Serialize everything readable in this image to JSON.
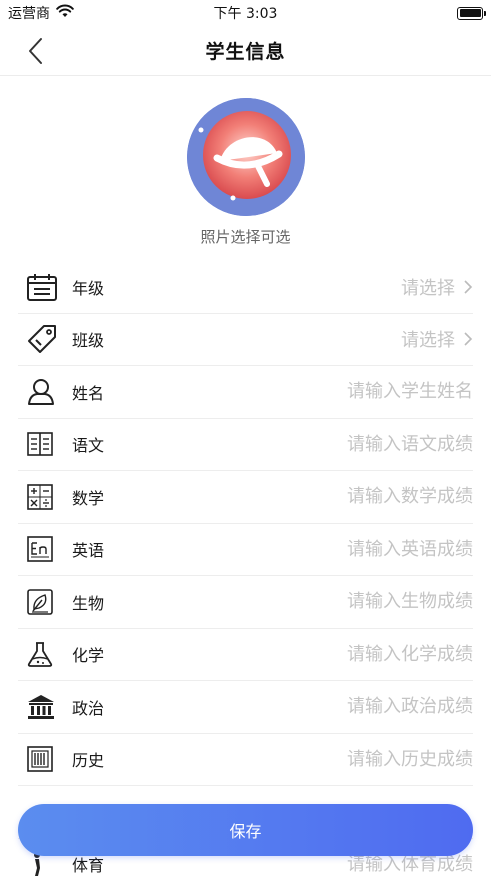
{
  "status_bar": {
    "carrier": "运营商",
    "time": "下午 3:03"
  },
  "nav": {
    "title": "学生信息"
  },
  "photo": {
    "hint": "照片选择可选"
  },
  "form": {
    "rows": [
      {
        "label": "年级",
        "placeholder": "请选择",
        "type": "select",
        "icon": "calendar-icon"
      },
      {
        "label": "班级",
        "placeholder": "请选择",
        "type": "select",
        "icon": "tag-icon"
      },
      {
        "label": "姓名",
        "placeholder": "请输入学生姓名",
        "type": "input",
        "icon": "person-icon"
      },
      {
        "label": "语文",
        "placeholder": "请输入语文成绩",
        "type": "input",
        "icon": "book-icon"
      },
      {
        "label": "数学",
        "placeholder": "请输入数学成绩",
        "type": "input",
        "icon": "math-symbols-icon"
      },
      {
        "label": "英语",
        "placeholder": "请输入英语成绩",
        "type": "input",
        "icon": "english-icon"
      },
      {
        "label": "生物",
        "placeholder": "请输入生物成绩",
        "type": "input",
        "icon": "leaf-icon"
      },
      {
        "label": "化学",
        "placeholder": "请输入化学成绩",
        "type": "input",
        "icon": "flask-icon"
      },
      {
        "label": "政治",
        "placeholder": "请输入政治成绩",
        "type": "input",
        "icon": "government-building-icon"
      },
      {
        "label": "历史",
        "placeholder": "请输入历史成绩",
        "type": "input",
        "icon": "archive-icon"
      },
      {
        "label": "",
        "placeholder": "",
        "type": "input",
        "icon": ""
      },
      {
        "label": "体育",
        "placeholder": "请输入体育成绩",
        "type": "input",
        "icon": "sports-icon"
      }
    ]
  },
  "save_button": {
    "label": "保存"
  },
  "colors": {
    "accent_start": "#5b8def",
    "accent_end": "#4f6bf0",
    "avatar_ring": "#6f86d6"
  }
}
